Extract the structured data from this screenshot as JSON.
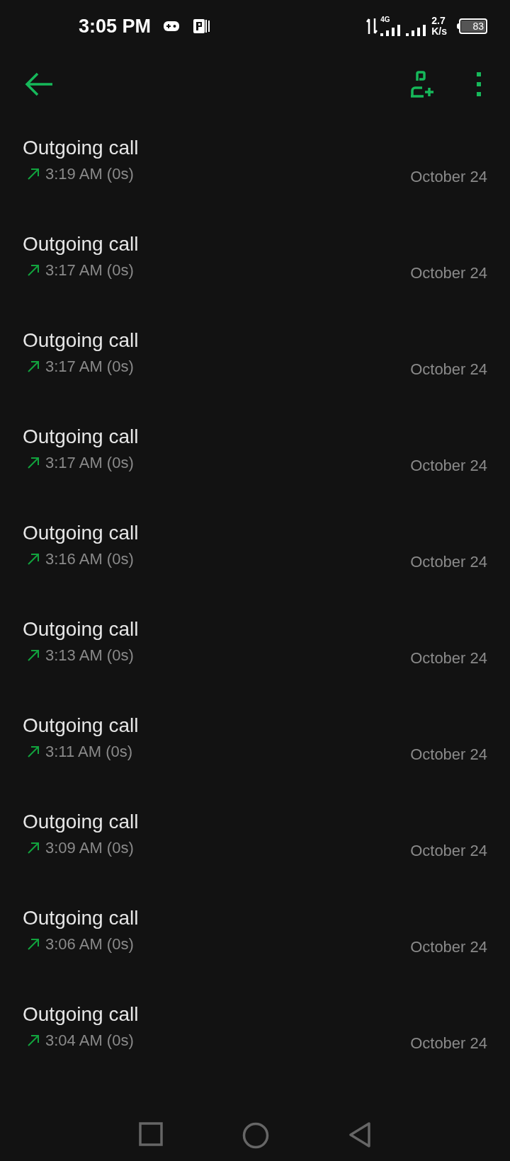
{
  "status_bar": {
    "time": "3:05 PM",
    "network": "4G",
    "speed_value": "2.7",
    "speed_unit": "K/s",
    "battery": "83"
  },
  "calls": [
    {
      "title": "Outgoing call",
      "detail": "3:19 AM (0s)",
      "date": "October 24"
    },
    {
      "title": "Outgoing call",
      "detail": "3:17 AM (0s)",
      "date": "October 24"
    },
    {
      "title": "Outgoing call",
      "detail": "3:17 AM (0s)",
      "date": "October 24"
    },
    {
      "title": "Outgoing call",
      "detail": "3:17 AM (0s)",
      "date": "October 24"
    },
    {
      "title": "Outgoing call",
      "detail": "3:16 AM (0s)",
      "date": "October 24"
    },
    {
      "title": "Outgoing call",
      "detail": "3:13 AM (0s)",
      "date": "October 24"
    },
    {
      "title": "Outgoing call",
      "detail": "3:11 AM (0s)",
      "date": "October 24"
    },
    {
      "title": "Outgoing call",
      "detail": "3:09 AM (0s)",
      "date": "October 24"
    },
    {
      "title": "Outgoing call",
      "detail": "3:06 AM (0s)",
      "date": "October 24"
    },
    {
      "title": "Outgoing call",
      "detail": "3:04 AM (0s)",
      "date": "October 24"
    }
  ]
}
